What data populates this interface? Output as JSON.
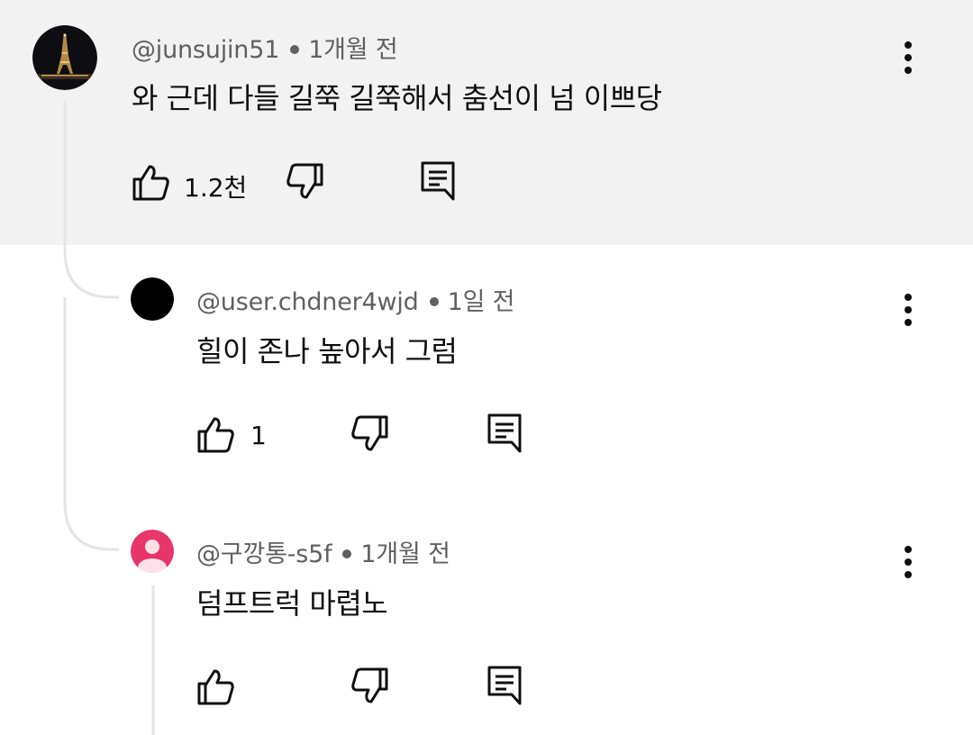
{
  "comments": [
    {
      "handle": "@junsujin51",
      "time": "1개월 전",
      "text": "와 근데 다들 길쭉 길쭉해서 춤선이 넘 이쁘당",
      "likes": "1.2천",
      "avatar_icon": "eiffel-tower-night-photo"
    },
    {
      "handle": "@user.chdner4wjd",
      "time": "1일 전",
      "text": "힐이 존나 높아서 그럼",
      "likes": "1",
      "avatar_icon": "black-circle"
    },
    {
      "handle": "@구깡통-s5f",
      "time": "1개월 전",
      "text": "덤프트럭 마렵노",
      "likes": "",
      "avatar_icon": "default-person-avatar"
    }
  ],
  "icons": {
    "like": "thumbs-up-icon",
    "dislike": "thumbs-down-icon",
    "reply": "reply-comment-icon",
    "menu": "more-vert-icon"
  },
  "colors": {
    "highlight_bg": "#f2f2f2",
    "meta_text": "#606060",
    "thread_line": "#e5e5e5",
    "default_avatar": "#e8356a"
  }
}
